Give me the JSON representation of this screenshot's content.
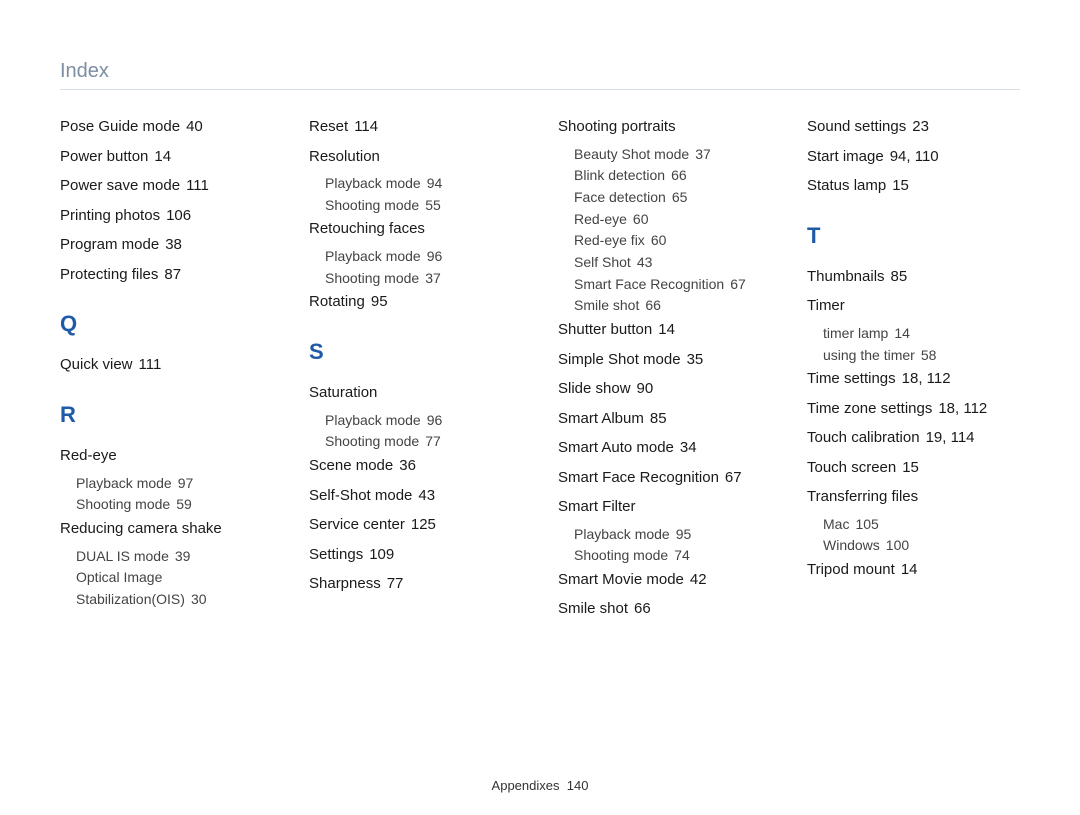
{
  "header": "Index",
  "footer": {
    "label": "Appendixes",
    "page": "140"
  },
  "columns": [
    {
      "items": [
        {
          "type": "entry",
          "term": "Pose Guide mode",
          "pages": "40"
        },
        {
          "type": "entry",
          "term": "Power button",
          "pages": "14"
        },
        {
          "type": "entry",
          "term": "Power save mode",
          "pages": "111"
        },
        {
          "type": "entry",
          "term": "Printing photos",
          "pages": "106"
        },
        {
          "type": "entry",
          "term": "Program mode",
          "pages": "38"
        },
        {
          "type": "entry",
          "term": "Protecting files",
          "pages": "87"
        },
        {
          "type": "letter",
          "term": "Q"
        },
        {
          "type": "entry",
          "term": "Quick view",
          "pages": "111"
        },
        {
          "type": "letter",
          "term": "R"
        },
        {
          "type": "entry",
          "term": "Red-eye",
          "pages": ""
        },
        {
          "type": "sub",
          "term": "Playback mode",
          "pages": "97"
        },
        {
          "type": "sub",
          "term": "Shooting mode",
          "pages": "59"
        },
        {
          "type": "entry",
          "term": "Reducing camera shake",
          "pages": ""
        },
        {
          "type": "sub",
          "term": "DUAL IS mode",
          "pages": "39"
        },
        {
          "type": "sub",
          "term": "Optical Image Stabilization(OIS)",
          "pages": "30"
        }
      ]
    },
    {
      "items": [
        {
          "type": "entry",
          "term": "Reset",
          "pages": "114"
        },
        {
          "type": "entry",
          "term": "Resolution",
          "pages": ""
        },
        {
          "type": "sub",
          "term": "Playback mode",
          "pages": "94"
        },
        {
          "type": "sub",
          "term": "Shooting mode",
          "pages": "55"
        },
        {
          "type": "entry",
          "term": "Retouching faces",
          "pages": ""
        },
        {
          "type": "sub",
          "term": "Playback mode",
          "pages": "96"
        },
        {
          "type": "sub",
          "term": "Shooting mode",
          "pages": "37"
        },
        {
          "type": "entry",
          "term": "Rotating",
          "pages": "95"
        },
        {
          "type": "letter",
          "term": "S"
        },
        {
          "type": "entry",
          "term": "Saturation",
          "pages": ""
        },
        {
          "type": "sub",
          "term": "Playback mode",
          "pages": "96"
        },
        {
          "type": "sub",
          "term": "Shooting mode",
          "pages": "77"
        },
        {
          "type": "entry",
          "term": "Scene mode",
          "pages": "36"
        },
        {
          "type": "entry",
          "term": "Self-Shot mode",
          "pages": "43"
        },
        {
          "type": "entry",
          "term": "Service center",
          "pages": "125"
        },
        {
          "type": "entry",
          "term": "Settings",
          "pages": "109"
        },
        {
          "type": "entry",
          "term": "Sharpness",
          "pages": "77"
        }
      ]
    },
    {
      "items": [
        {
          "type": "entry",
          "term": "Shooting portraits",
          "pages": ""
        },
        {
          "type": "sub",
          "term": "Beauty Shot mode",
          "pages": "37"
        },
        {
          "type": "sub",
          "term": "Blink detection",
          "pages": "66"
        },
        {
          "type": "sub",
          "term": "Face detection",
          "pages": "65"
        },
        {
          "type": "sub",
          "term": "Red-eye",
          "pages": "60"
        },
        {
          "type": "sub",
          "term": "Red-eye fix",
          "pages": "60"
        },
        {
          "type": "sub",
          "term": "Self Shot",
          "pages": "43"
        },
        {
          "type": "sub",
          "term": "Smart Face Recognition",
          "pages": "67"
        },
        {
          "type": "sub",
          "term": "Smile shot",
          "pages": "66"
        },
        {
          "type": "entry",
          "term": "Shutter button",
          "pages": "14"
        },
        {
          "type": "entry",
          "term": "Simple Shot mode",
          "pages": "35"
        },
        {
          "type": "entry",
          "term": "Slide show",
          "pages": "90"
        },
        {
          "type": "entry",
          "term": "Smart Album",
          "pages": "85"
        },
        {
          "type": "entry",
          "term": "Smart Auto mode",
          "pages": "34"
        },
        {
          "type": "entry",
          "term": "Smart Face Recognition",
          "pages": "67"
        },
        {
          "type": "entry",
          "term": "Smart Filter",
          "pages": ""
        },
        {
          "type": "sub",
          "term": "Playback mode",
          "pages": "95"
        },
        {
          "type": "sub",
          "term": "Shooting mode",
          "pages": "74"
        },
        {
          "type": "entry",
          "term": "Smart Movie mode",
          "pages": "42"
        },
        {
          "type": "entry",
          "term": "Smile shot",
          "pages": "66"
        }
      ]
    },
    {
      "items": [
        {
          "type": "entry",
          "term": "Sound settings",
          "pages": "23"
        },
        {
          "type": "entry",
          "term": "Start image",
          "pages": "94, 110"
        },
        {
          "type": "entry",
          "term": "Status lamp",
          "pages": "15"
        },
        {
          "type": "letter",
          "term": "T"
        },
        {
          "type": "entry",
          "term": "Thumbnails",
          "pages": "85"
        },
        {
          "type": "entry",
          "term": "Timer",
          "pages": ""
        },
        {
          "type": "sub",
          "term": "timer lamp",
          "pages": "14"
        },
        {
          "type": "sub",
          "term": "using the timer",
          "pages": "58"
        },
        {
          "type": "entry",
          "term": "Time settings",
          "pages": "18, 112"
        },
        {
          "type": "entry",
          "term": "Time zone settings",
          "pages": "18, 112"
        },
        {
          "type": "entry",
          "term": "Touch calibration",
          "pages": "19, 114"
        },
        {
          "type": "entry",
          "term": "Touch screen",
          "pages": "15"
        },
        {
          "type": "entry",
          "term": "Transferring files",
          "pages": ""
        },
        {
          "type": "sub",
          "term": "Mac",
          "pages": "105"
        },
        {
          "type": "sub",
          "term": "Windows",
          "pages": "100"
        },
        {
          "type": "entry",
          "term": "Tripod mount",
          "pages": "14"
        }
      ]
    }
  ]
}
